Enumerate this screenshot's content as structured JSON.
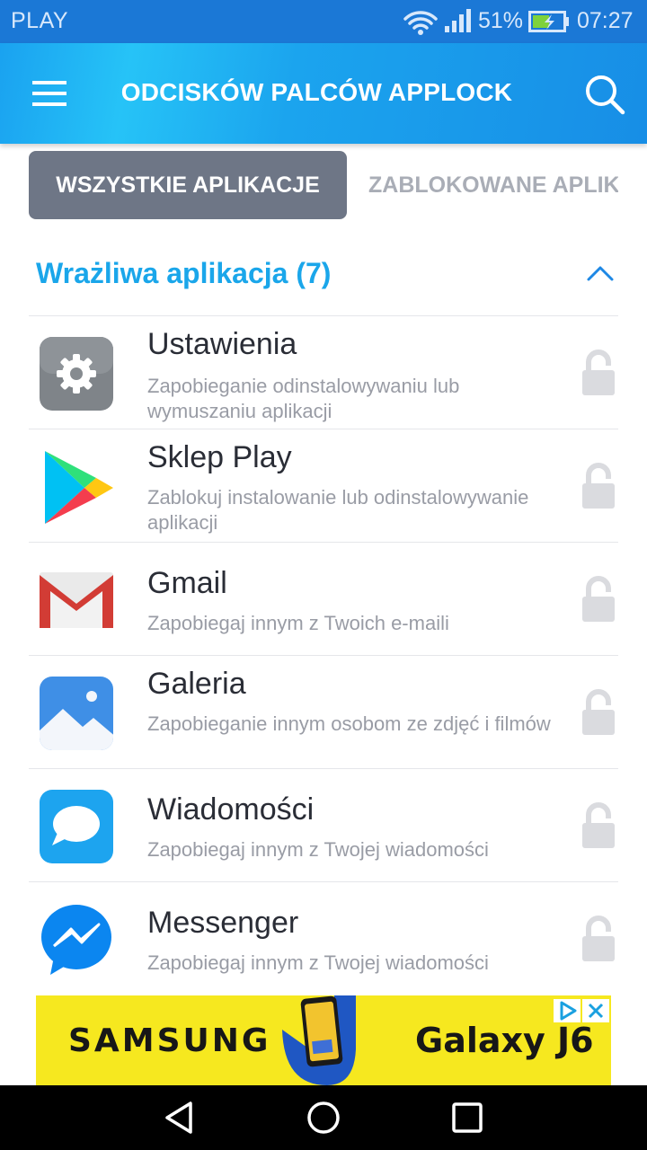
{
  "status_bar": {
    "carrier": "PLAY",
    "battery_percent": "51%",
    "time": "07:27"
  },
  "app_bar": {
    "title": "ODCISKÓW PALCÓW APPLOCK"
  },
  "tabs": {
    "all_apps": "WSZYSTKIE APLIKACJE",
    "locked_apps": "ZABLOKOWANE APLIKACJE"
  },
  "section": {
    "title": "Wrażliwa aplikacja (7)"
  },
  "apps": [
    {
      "name": "Ustawienia",
      "description": "Zapobieganie odinstalowywaniu lub wymuszaniu aplikacji",
      "icon": "settings-icon"
    },
    {
      "name": "Sklep Play",
      "description": "Zablokuj instalowanie lub odinstalowywanie aplikacji",
      "icon": "play-store-icon"
    },
    {
      "name": "Gmail",
      "description": "Zapobiegaj innym z Twoich e-maili",
      "icon": "gmail-icon"
    },
    {
      "name": "Galeria",
      "description": "Zapobieganie innym osobom ze zdjęć i filmów",
      "icon": "gallery-icon"
    },
    {
      "name": "Wiadomości",
      "description": "Zapobiegaj innym z Twojej wiadomości",
      "icon": "messages-icon"
    },
    {
      "name": "Messenger",
      "description": "Zapobiegaj innym z Twojej wiadomości",
      "icon": "messenger-icon"
    }
  ],
  "ad": {
    "brand": "SAMSUNG",
    "product": "Galaxy J6"
  },
  "colors": {
    "status_bar": "#1b78d6",
    "app_bar": "#1aa2f0",
    "accent": "#1aa6ea",
    "active_tab": "#6e7686",
    "ad_background": "#f6e81f"
  }
}
